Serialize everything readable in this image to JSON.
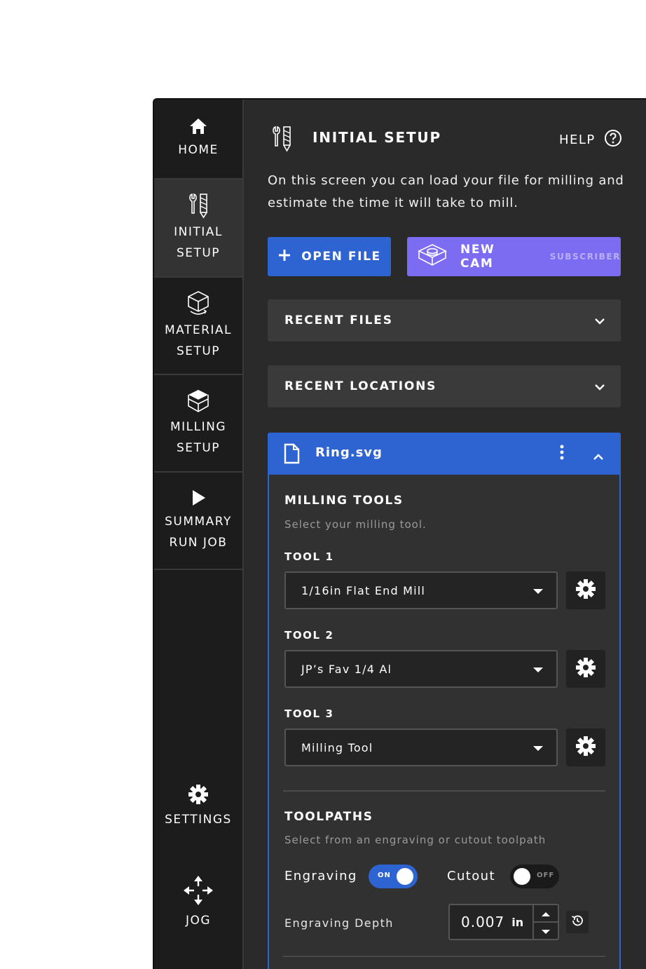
{
  "sidebar": {
    "home": "HOME",
    "initial_setup": [
      "INITIAL",
      "SETUP"
    ],
    "material_setup": [
      "MATERIAL",
      "SETUP"
    ],
    "milling_setup": [
      "MILLING",
      "SETUP"
    ],
    "summary_run_job": [
      "SUMMARY",
      "RUN JOB"
    ],
    "settings": "SETTINGS",
    "jog": "JOG"
  },
  "header": {
    "title": "INITIAL SETUP",
    "help": "HELP",
    "intro": "On this screen you can load your file for milling and estimate the time it will take to mill."
  },
  "actions": {
    "open_file": "OPEN FILE",
    "new_cam": "NEW CAM",
    "subscriber_tag": "SUBSCRIBER"
  },
  "accordions": {
    "recent_files": "RECENT FILES",
    "recent_locations": "RECENT LOCATIONS"
  },
  "file": {
    "name": "Ring.svg",
    "milling_tools": {
      "title": "MILLING TOOLS",
      "subtitle": "Select your milling tool.",
      "tools": [
        {
          "label": "TOOL 1",
          "value": "1/16in Flat End Mill"
        },
        {
          "label": "TOOL 2",
          "value": "JP’s Fav 1/4 Al"
        },
        {
          "label": "TOOL 3",
          "value": "Milling Tool"
        }
      ]
    },
    "toolpaths": {
      "title": "TOOLPATHS",
      "subtitle": "Select from an engraving or cutout toolpath",
      "engraving_label": "Engraving",
      "engraving_state": "ON",
      "cutout_label": "Cutout",
      "cutout_state": "OFF",
      "depth_label": "Engraving Depth",
      "depth_value": "0.007",
      "depth_unit": "in"
    }
  },
  "colors": {
    "accent_blue": "#2e64d2",
    "cam_purple": "#7b6cf2",
    "panel_bg": "#2a2a2a",
    "sidebar_bg": "#1c1c1c"
  }
}
